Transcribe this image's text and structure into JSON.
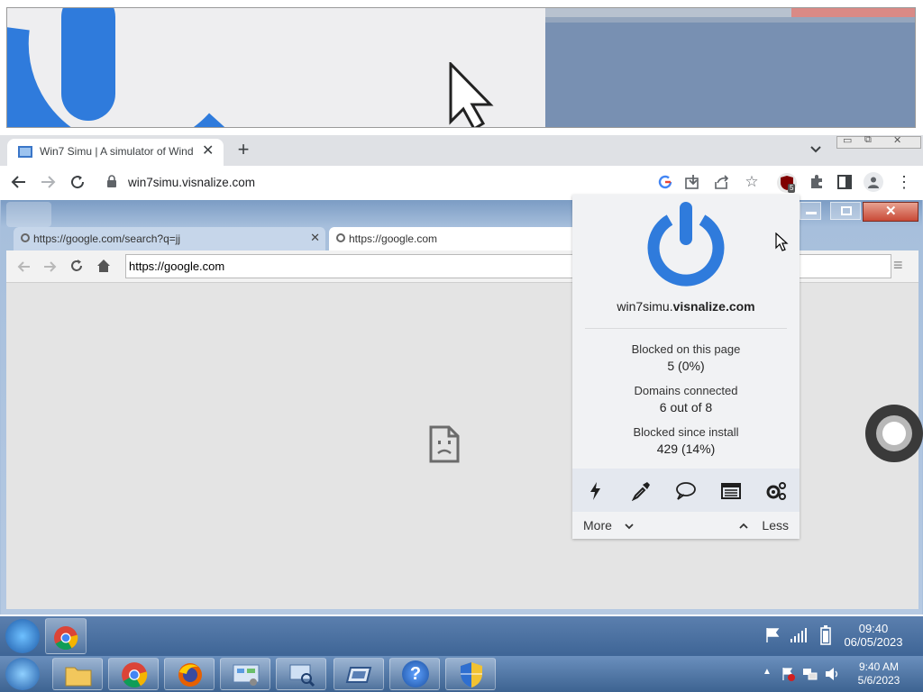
{
  "outer_browser": {
    "tab_title": "Win7 Simu | A simulator of Wind",
    "address": "win7simu.visnalize.com",
    "ublock_badge": "5"
  },
  "win7": {
    "tabs": [
      {
        "label": "https://google.com/search?q=jj"
      },
      {
        "label": "https://google.com"
      }
    ],
    "address_value": "https://google.com"
  },
  "ublock_popup": {
    "host_sub": "win7simu.",
    "host_domain": "visnalize.com",
    "blocked_page_label": "Blocked on this page",
    "blocked_page_value": "5 (0%)",
    "domains_label": "Domains connected",
    "domains_value": "6 out of 8",
    "blocked_install_label": "Blocked since install",
    "blocked_install_value": "429 (14%)",
    "more_label": "More",
    "less_label": "Less",
    "power_color": "#2f7bdc"
  },
  "taskbar": {
    "upper_time": "09:40",
    "upper_date": "06/05/2023",
    "lower_time": "9:40 AM",
    "lower_date": "5/6/2023"
  }
}
